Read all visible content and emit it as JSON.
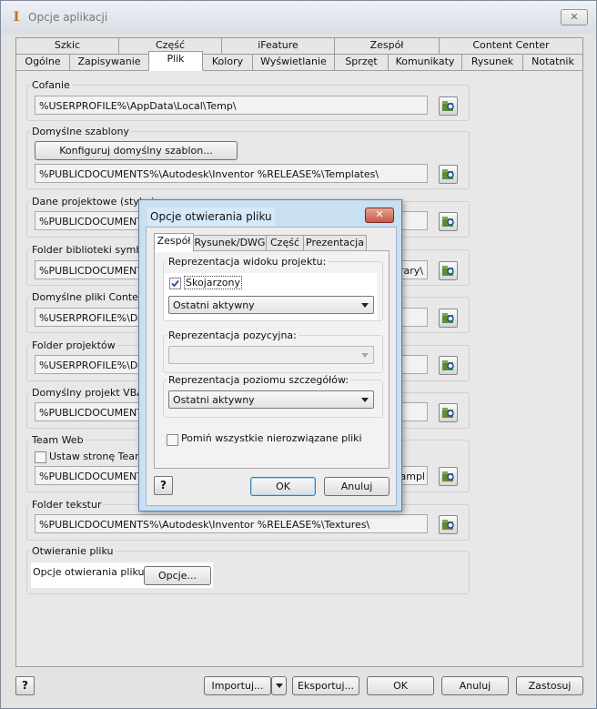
{
  "window": {
    "title": "Opcje aplikacji",
    "icon": "app-icon",
    "close": "✕"
  },
  "tabs_row1": [
    "Szkic",
    "Część",
    "iFeature",
    "Zespół",
    "Content Center"
  ],
  "tabs_row2": [
    "Ogólne",
    "Zapisywanie",
    "Plik",
    "Kolory",
    "Wyświetlanie",
    "Sprzęt",
    "Komunikaty",
    "Rysunek",
    "Notatnik"
  ],
  "active_tab": "Plik",
  "sections": {
    "undo": {
      "label": "Cofanie",
      "path": "%USERPROFILE%\\AppData\\Local\\Temp\\"
    },
    "templates": {
      "label": "Domyślne szablony",
      "button": "Konfiguruj domyślny szablon...",
      "path": "%PUBLICDOCUMENTS%\\Autodesk\\Inventor %RELEASE%\\Templates\\"
    },
    "design_data": {
      "label": "Dane projektowe (style i...",
      "path": "%PUBLICDOCUMENTS%"
    },
    "symbol_library": {
      "label": "Folder biblioteki symboli s",
      "path": "%PUBLICDOCUMENTS",
      "path_tail": "rary\\"
    },
    "content_center": {
      "label": "Domyślne pliki Content C",
      "path": "%USERPROFILE%\\Doc"
    },
    "projects": {
      "label": "Folder projektów",
      "path": "%USERPROFILE%\\Doc"
    },
    "vba": {
      "label": "Domyślny projekt VBA",
      "path": "%PUBLICDOCUMENTS"
    },
    "team_web": {
      "label": "Team Web",
      "checkbox": "Ustaw stronę Team W",
      "path": "%PUBLICDOCUMENTS",
      "path_tail": "Sampl"
    },
    "textures": {
      "label": "Folder tekstur",
      "path": "%PUBLICDOCUMENTS%\\Autodesk\\Inventor %RELEASE%\\Textures\\"
    },
    "file_open": {
      "label": "Otwieranie pliku",
      "text": "Opcje otwierania pliku",
      "button": "Opcje..."
    }
  },
  "footer": {
    "help": "?",
    "import": "Importuj...",
    "export": "Eksportuj...",
    "ok": "OK",
    "cancel": "Anuluj",
    "apply": "Zastosuj"
  },
  "dialog": {
    "title": "Opcje otwierania pliku",
    "close": "✕",
    "tabs": [
      "Zespół",
      "Rysunek/DWG",
      "Część",
      "Prezentacja"
    ],
    "active_tab": "Zespół",
    "view_rep": {
      "label": "Reprezentacja widoku projektu:",
      "checkbox": "Skojarzony",
      "checked": true,
      "value": "Ostatni aktywny"
    },
    "positional_rep": {
      "label": "Reprezentacja pozycyjna:",
      "value": ""
    },
    "lod_rep": {
      "label": "Reprezentacja poziomu szczegółów:",
      "value": "Ostatni aktywny"
    },
    "skip_unresolved": {
      "label": "Pomiń wszystkie nierozwiązane pliki",
      "checked": false
    },
    "help": "?",
    "ok": "OK",
    "cancel": "Anuluj"
  }
}
